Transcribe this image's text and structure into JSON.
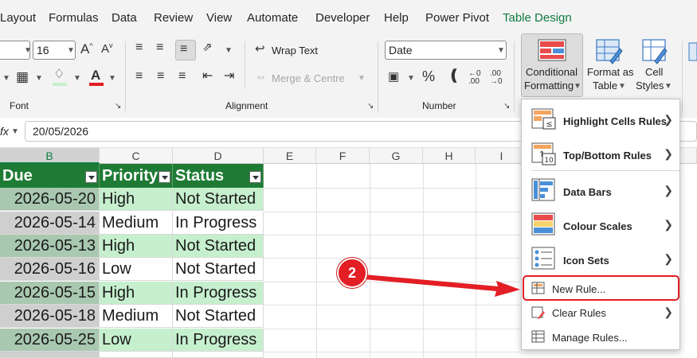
{
  "menu_tabs": [
    "Layout",
    "Formulas",
    "Data",
    "Review",
    "View",
    "Automate",
    "Developer",
    "Help",
    "Power Pivot",
    "Table Design"
  ],
  "ribbon": {
    "font_size": "16",
    "wrap_text": "Wrap Text",
    "merge_centre": "Merge & Centre",
    "number_format": "Date",
    "conditional_formatting": [
      "Conditional",
      "Formatting"
    ],
    "format_as_table": [
      "Format as",
      "Table"
    ],
    "cell_styles": [
      "Cell",
      "Styles"
    ],
    "groups": {
      "font": "Font",
      "alignment": "Alignment",
      "number": "Number"
    }
  },
  "formula_bar": {
    "fx": "fx",
    "value": "20/05/2026"
  },
  "columns": [
    "B",
    "C",
    "D",
    "E",
    "F",
    "G",
    "H",
    "I"
  ],
  "table": {
    "headers": [
      "Due",
      "Priority",
      "Status"
    ],
    "rows": [
      [
        "2026-05-20",
        "High",
        "Not Started"
      ],
      [
        "2026-05-14",
        "Medium",
        "In Progress"
      ],
      [
        "2026-05-13",
        "High",
        "Not Started"
      ],
      [
        "2026-05-16",
        "Low",
        "Not Started"
      ],
      [
        "2026-05-15",
        "High",
        "In Progress"
      ],
      [
        "2026-05-18",
        "Medium",
        "Not Started"
      ],
      [
        "2026-05-25",
        "Low",
        "In Progress"
      ]
    ]
  },
  "dropdown": {
    "items": [
      {
        "label": "Highlight Cells Rules",
        "icon": "highlight-cells-icon",
        "submenu": true
      },
      {
        "label": "Top/Bottom Rules",
        "icon": "top-bottom-icon",
        "submenu": true
      },
      {
        "label": "Data Bars",
        "icon": "data-bars-icon",
        "submenu": true
      },
      {
        "label": "Colour Scales",
        "icon": "colour-scales-icon",
        "submenu": true
      },
      {
        "label": "Icon Sets",
        "icon": "icon-sets-icon",
        "submenu": true
      },
      {
        "label": "New Rule...",
        "icon": "new-rule-icon",
        "submenu": false
      },
      {
        "label": "Clear Rules",
        "icon": "clear-rules-icon",
        "submenu": true
      },
      {
        "label": "Manage Rules...",
        "icon": "manage-rules-icon",
        "submenu": false
      }
    ]
  },
  "annotation": {
    "step": "2",
    "color": "#e31e24"
  },
  "colors": {
    "table_header": "#1e7b34",
    "row_fill": "#c6efce",
    "accent": "#107c41"
  }
}
